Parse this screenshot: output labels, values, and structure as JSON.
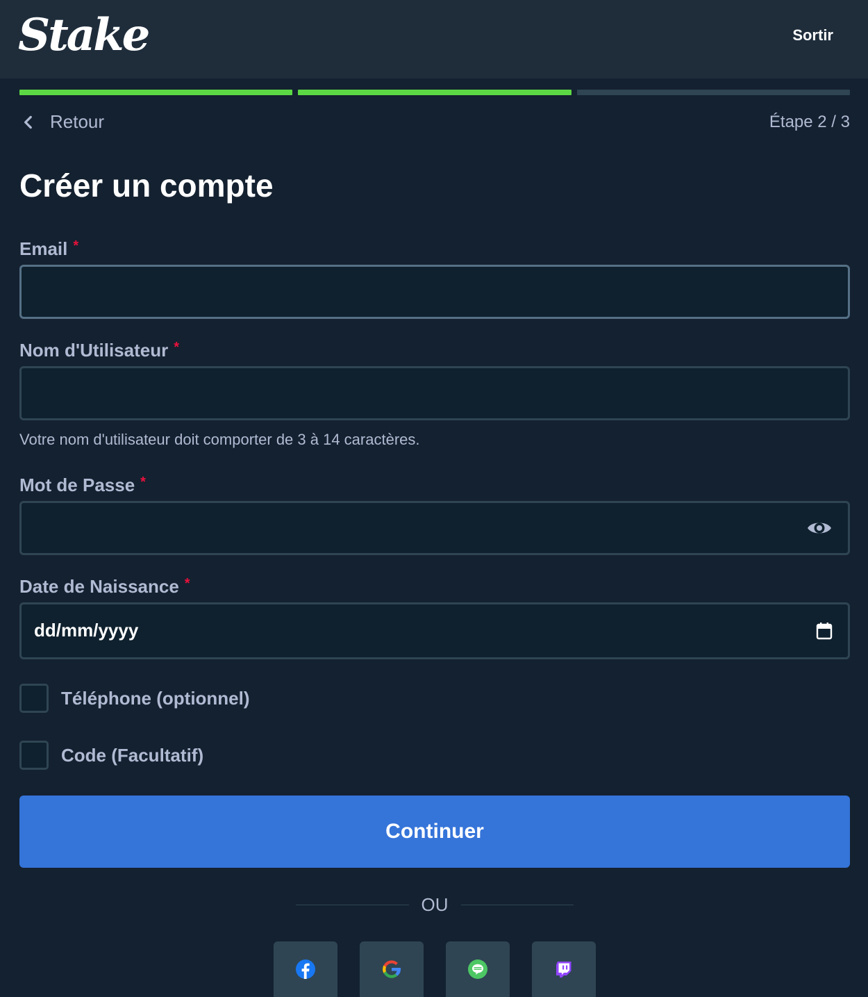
{
  "header": {
    "logo_text": "Stake",
    "exit_label": "Sortir"
  },
  "progress": {
    "total_steps": 3,
    "completed_steps": 2,
    "active_color": "#5cd844",
    "inactive_color": "#2f4553"
  },
  "nav": {
    "back_label": "Retour",
    "step_text": "Étape 2 / 3"
  },
  "form": {
    "title": "Créer un compte",
    "email": {
      "label": "Email",
      "required_mark": "*",
      "value": ""
    },
    "username": {
      "label": "Nom d'Utilisateur",
      "required_mark": "*",
      "value": "",
      "hint": "Votre nom d'utilisateur doit comporter de 3 à 14 caractères."
    },
    "password": {
      "label": "Mot de Passe",
      "required_mark": "*",
      "value": ""
    },
    "birthdate": {
      "label": "Date de Naissance",
      "required_mark": "*",
      "placeholder": "dd/mm/yyyy"
    },
    "phone_option": {
      "label": "Téléphone (optionnel)",
      "checked": false
    },
    "code_option": {
      "label": "Code (Facultatif)",
      "checked": false
    },
    "submit_label": "Continuer",
    "divider_text": "OU"
  },
  "socials": [
    {
      "icon": "facebook-icon"
    },
    {
      "icon": "google-icon"
    },
    {
      "icon": "line-icon"
    },
    {
      "icon": "twitch-icon"
    }
  ],
  "colors": {
    "background": "#142130",
    "header": "#1f2d3b",
    "primary_button": "#3574d9",
    "required": "#e9113c"
  }
}
